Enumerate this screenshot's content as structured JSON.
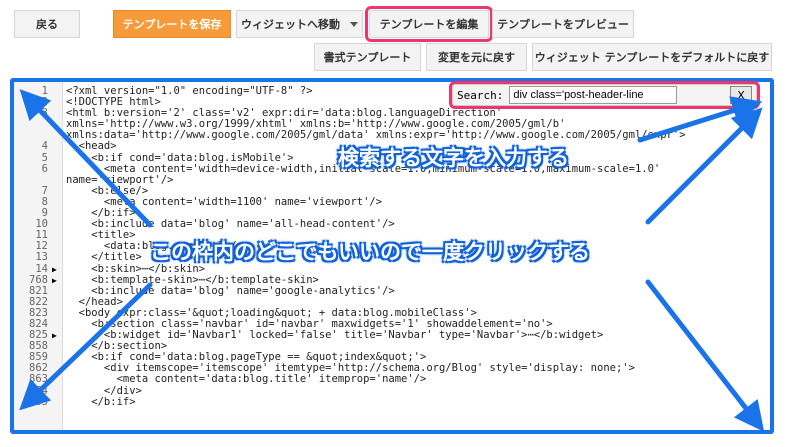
{
  "toolbar": {
    "back": "戻る",
    "save": "テンプレートを保存",
    "jump_widget": "ウィジェットへ移動",
    "edit_template": "テンプレートを編集",
    "preview_template": "テンプレートをプレビュー",
    "format_template": "書式テンプレート",
    "revert": "変更を元に戻す",
    "widget_default": "ウィジェット テンプレートをデフォルトに戻す"
  },
  "search": {
    "label": "Search:",
    "value": "div class='post-header-line",
    "close": "X"
  },
  "annotations": {
    "enter_text": "検索する文字を入力する",
    "click_inside": "この枠内のどこでもいいので一度クリックする"
  },
  "code_lines": [
    {
      "num": "1",
      "fold": "",
      "text": "<?xml version=\"1.0\" encoding=\"UTF-8\" ?>"
    },
    {
      "num": "2",
      "fold": "",
      "text": "<!DOCTYPE html>"
    },
    {
      "num": "3",
      "fold": "",
      "text": "<html b:version='2' class='v2' expr:dir='data:blog.languageDirection'"
    },
    {
      "num": "",
      "fold": "",
      "text": "xmlns='http://www.w3.org/1999/xhtml' xmlns:b='http://www.google.com/2005/gml/b'"
    },
    {
      "num": "",
      "fold": "",
      "text": "xmlns:data='http://www.google.com/2005/gml/data' xmlns:expr='http://www.google.com/2005/gml/expr'>"
    },
    {
      "num": "4",
      "fold": "",
      "text": "  <head>"
    },
    {
      "num": "5",
      "fold": "",
      "text": "    <b:if cond='data:blog.isMobile'>"
    },
    {
      "num": "6",
      "fold": "",
      "text": "      <meta content='width=device-width,initial-scale=1.0,minimum-scale=1.0,maximum-scale=1.0'"
    },
    {
      "num": "",
      "fold": "",
      "text": "name='viewport'/>"
    },
    {
      "num": "7",
      "fold": "",
      "text": "    <b:else/>"
    },
    {
      "num": "8",
      "fold": "",
      "text": "      <meta content='width=1100' name='viewport'/>"
    },
    {
      "num": "9",
      "fold": "",
      "text": "    </b:if>"
    },
    {
      "num": "10",
      "fold": "",
      "text": "    <b:include data='blog' name='all-head-content'/>"
    },
    {
      "num": "11",
      "fold": "",
      "text": "    <title>"
    },
    {
      "num": "12",
      "fold": "",
      "text": "      <data:blog.pageTitle/>"
    },
    {
      "num": "13",
      "fold": "",
      "text": "    </title>"
    },
    {
      "num": "14",
      "fold": "▶",
      "text": "    <b:skin>⋯</b:skin>"
    },
    {
      "num": "768",
      "fold": "▶",
      "text": "    <b:template-skin>⋯</b:template-skin>"
    },
    {
      "num": "821",
      "fold": "",
      "text": "    <b:include data='blog' name='google-analytics'/>"
    },
    {
      "num": "822",
      "fold": "",
      "text": "  </head>"
    },
    {
      "num": "823",
      "fold": "",
      "text": "  <body expr:class='&quot;loading&quot; + data:blog.mobileClass'>"
    },
    {
      "num": "824",
      "fold": "",
      "text": "    <b:section class='navbar' id='navbar' maxwidgets='1' showaddelement='no'>"
    },
    {
      "num": "825",
      "fold": "▶",
      "text": "      <b:widget id='Navbar1' locked='false' title='Navbar' type='Navbar'>⋯</b:widget>"
    },
    {
      "num": "858",
      "fold": "",
      "text": "    </b:section>"
    },
    {
      "num": "859",
      "fold": "",
      "text": "    <b:if cond='data:blog.pageType == &quot;index&quot;'>"
    },
    {
      "num": "862",
      "fold": "",
      "text": "      <div itemscope='itemscope' itemtype='http://schema.org/Blog' style='display: none;'>"
    },
    {
      "num": "863",
      "fold": "",
      "text": "        <meta content='data:blog.title' itemprop='name'/>"
    },
    {
      "num": "864",
      "fold": "",
      "text": "      </div>"
    },
    {
      "num": "865",
      "fold": "",
      "text": "    </b:if>"
    }
  ],
  "colors": {
    "accent_blue": "#1a73e8",
    "highlight_pink": "#e8386d",
    "save_orange": "#f79a3a"
  }
}
